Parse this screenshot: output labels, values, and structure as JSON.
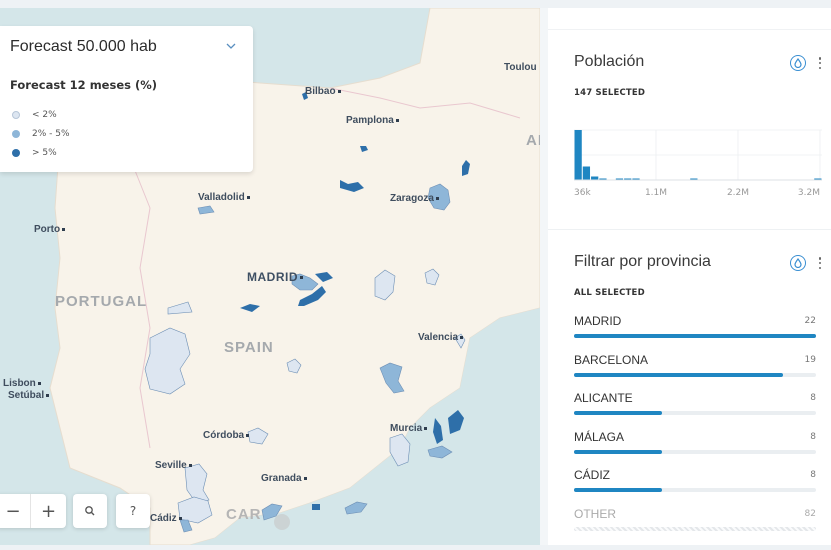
{
  "legend": {
    "title": "Forecast 50.000 hab",
    "subtitle": "Forecast 12 meses (%)",
    "items": [
      {
        "label": "< 2%",
        "color": "#dde6f1"
      },
      {
        "label": "2% - 5%",
        "color": "#8eb6d8"
      },
      {
        "label": "> 5%",
        "color": "#2e6fa9"
      }
    ]
  },
  "map": {
    "cities": [
      "Bilbao",
      "Pamplona",
      "Zaragoza",
      "Valladolid",
      "Porto",
      "Valencia",
      "Lisbon",
      "Setúbal",
      "Córdoba",
      "Murcia",
      "Seville",
      "Granada",
      "Cádiz",
      "Toulou"
    ],
    "capital": "MADRID",
    "countries": [
      "PORTUGAL",
      "SPAIN",
      "AI",
      "CAR"
    ],
    "controls": {
      "zoom_out": "−",
      "zoom_in": "+",
      "search": "search",
      "help": "?"
    }
  },
  "widgets": {
    "poblacion": {
      "title": "Población",
      "selected": "147 SELECTED",
      "chart_data": {
        "type": "bar",
        "title": "Población",
        "x_ticks": [
          "36k",
          "1.1M",
          "2.2M",
          "3.2M"
        ],
        "xlim": [
          36000,
          3200000
        ],
        "bins_relative_height": [
          1.0,
          0.27,
          0.07,
          0.03,
          0,
          0.02,
          0.02,
          0.02,
          0,
          0,
          0,
          0,
          0,
          0,
          0.02,
          0,
          0,
          0,
          0,
          0,
          0,
          0,
          0,
          0,
          0,
          0,
          0,
          0,
          0,
          0.02
        ],
        "accent_color": "#1f86c2",
        "grid": true
      }
    },
    "provincia": {
      "title": "Filtrar por provincia",
      "selected": "ALL SELECTED",
      "categories": [
        {
          "name": "MADRID",
          "value": 22
        },
        {
          "name": "BARCELONA",
          "value": 19
        },
        {
          "name": "ALICANTE",
          "value": 8
        },
        {
          "name": "MÁLAGA",
          "value": 8
        },
        {
          "name": "CÁDIZ",
          "value": 8
        }
      ],
      "other": {
        "name": "OTHER",
        "value": 82
      },
      "max": 22,
      "accent_color": "#1f86c2"
    }
  }
}
